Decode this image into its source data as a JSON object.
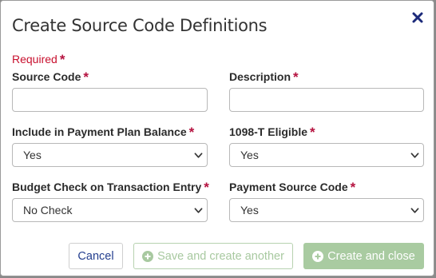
{
  "dialog": {
    "title": "Create Source Code Definitions",
    "required_note": "Required",
    "required_marker": "*"
  },
  "fields": {
    "source_code": {
      "label": "Source Code",
      "value": ""
    },
    "description": {
      "label": "Description",
      "value": ""
    },
    "payment_plan_balance": {
      "label": "Include in Payment Plan Balance",
      "value": "Yes"
    },
    "eligible_1098t": {
      "label": "1098-T Eligible",
      "value": "Yes"
    },
    "budget_check": {
      "label": "Budget Check on Transaction Entry",
      "value": "No Check"
    },
    "payment_source_code": {
      "label": "Payment Source Code",
      "value": "Yes"
    }
  },
  "buttons": {
    "cancel": "Cancel",
    "save_and_create_another": "Save and create another",
    "create_and_close": "Create and close"
  },
  "icons": {
    "close": "close-icon",
    "chevron": "chevron-down-icon",
    "plus": "plus-circle-icon"
  },
  "colors": {
    "required": "#c8102e",
    "primary_button_disabled": "#a9cba1",
    "link": "#243f8f",
    "close_icon": "#1c2a7a"
  }
}
